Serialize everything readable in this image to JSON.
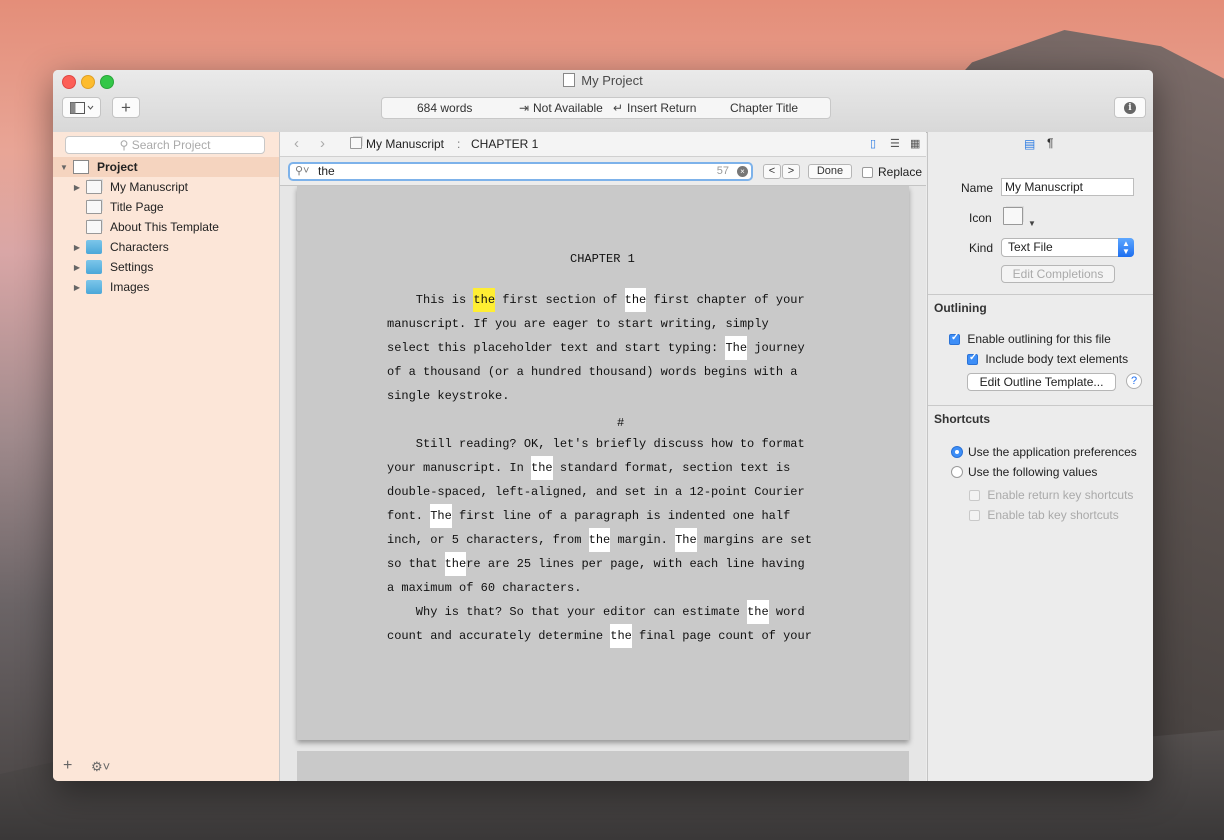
{
  "window": {
    "title": "My Project"
  },
  "toolbar": {
    "words": "684 words",
    "not_available": "Not Available",
    "insert_return": "Insert Return",
    "chapter_title": "Chapter Title",
    "add_label": "+",
    "info_label": "i"
  },
  "binder": {
    "search_placeholder": "Search Project",
    "items": [
      {
        "label": "Project",
        "icon": "project-icon",
        "disclosure": "▼"
      },
      {
        "label": "My Manuscript",
        "icon": "document-stack-icon",
        "disclosure": "▶"
      },
      {
        "label": "Title Page",
        "icon": "document-icon",
        "disclosure": ""
      },
      {
        "label": "About This Template",
        "icon": "document-icon",
        "disclosure": ""
      },
      {
        "label": "Characters",
        "icon": "folder-icon",
        "disclosure": "▶"
      },
      {
        "label": "Settings",
        "icon": "folder-icon",
        "disclosure": "▶"
      },
      {
        "label": "Images",
        "icon": "folder-icon",
        "disclosure": "▶"
      }
    ],
    "add_label": "+",
    "gear_label": "⚙︎˅"
  },
  "editor": {
    "breadcrumb_doc": "My Manuscript",
    "breadcrumb_sep": ":",
    "breadcrumb_section": "CHAPTER 1",
    "find": {
      "query": "the",
      "count": "57",
      "prev": "<",
      "next": ">",
      "done": "Done",
      "replace": "Replace"
    },
    "chapter_heading": "CHAPTER 1",
    "separator": "#"
  },
  "inspector": {
    "name_label": "Name",
    "name_value": "My Manuscript",
    "icon_label": "Icon",
    "kind_label": "Kind",
    "kind_value": "Text File",
    "edit_completions": "Edit Completions",
    "outlining_title": "Outlining",
    "enable_outlining": "Enable outlining for this file",
    "include_body": "Include body text elements",
    "edit_outline_template": "Edit Outline Template...",
    "help": "?",
    "shortcuts_title": "Shortcuts",
    "use_app_prefs": "Use the application preferences",
    "use_following": "Use the following values",
    "enable_return": "Enable return key shortcuts",
    "enable_tab": "Enable tab key shortcuts"
  }
}
